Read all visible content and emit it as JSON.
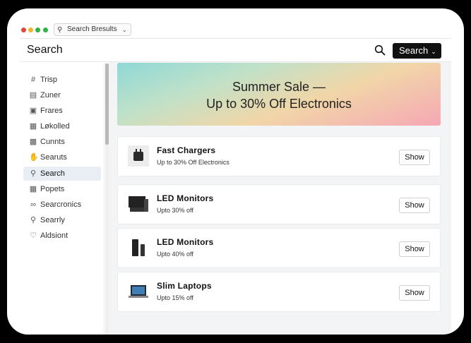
{
  "tab": {
    "label": "Search Bresults"
  },
  "header": {
    "title": "Search",
    "search_button": "Search"
  },
  "sidebar": {
    "items": [
      {
        "label": "Trisp",
        "icon": "hash-icon"
      },
      {
        "label": "Zuner",
        "icon": "clipboard-icon"
      },
      {
        "label": "Frares",
        "icon": "chart-icon"
      },
      {
        "label": "Løkolled",
        "icon": "calendar-icon"
      },
      {
        "label": "Cunnts",
        "icon": "card-icon"
      },
      {
        "label": "Searuts",
        "icon": "thumb-icon"
      },
      {
        "label": "Search",
        "icon": "search-icon",
        "active": true
      },
      {
        "label": "Popets",
        "icon": "grid-icon"
      },
      {
        "label": "Searcronics",
        "icon": "link-icon"
      },
      {
        "label": "Searrly",
        "icon": "search-icon"
      },
      {
        "label": "Aldsiont",
        "icon": "heart-icon"
      }
    ]
  },
  "banner": {
    "line1": "Summer Sale —",
    "line2": "Up to 30% Off Electronics"
  },
  "products": [
    {
      "name": "Fast Chargers",
      "subtitle": "Up to 30% Off Electronics",
      "button": "Show",
      "icon": "charger-icon"
    },
    {
      "name": "LED Monitors",
      "subtitle": "Upto 30% off",
      "button": "Show",
      "icon": "monitor-icon"
    },
    {
      "name": "LED Monitors",
      "subtitle": "Upto 40% off",
      "button": "Show",
      "icon": "speaker-icon"
    },
    {
      "name": "Slim Laptops",
      "subtitle": "Upto 15% off",
      "button": "Show",
      "icon": "laptop-icon"
    }
  ],
  "colors": {
    "accent": "#111111",
    "active_bg": "#e9eef4",
    "traffic_red": "#e2453c",
    "traffic_yellow": "#f0b429",
    "traffic_green": "#2fb344"
  }
}
